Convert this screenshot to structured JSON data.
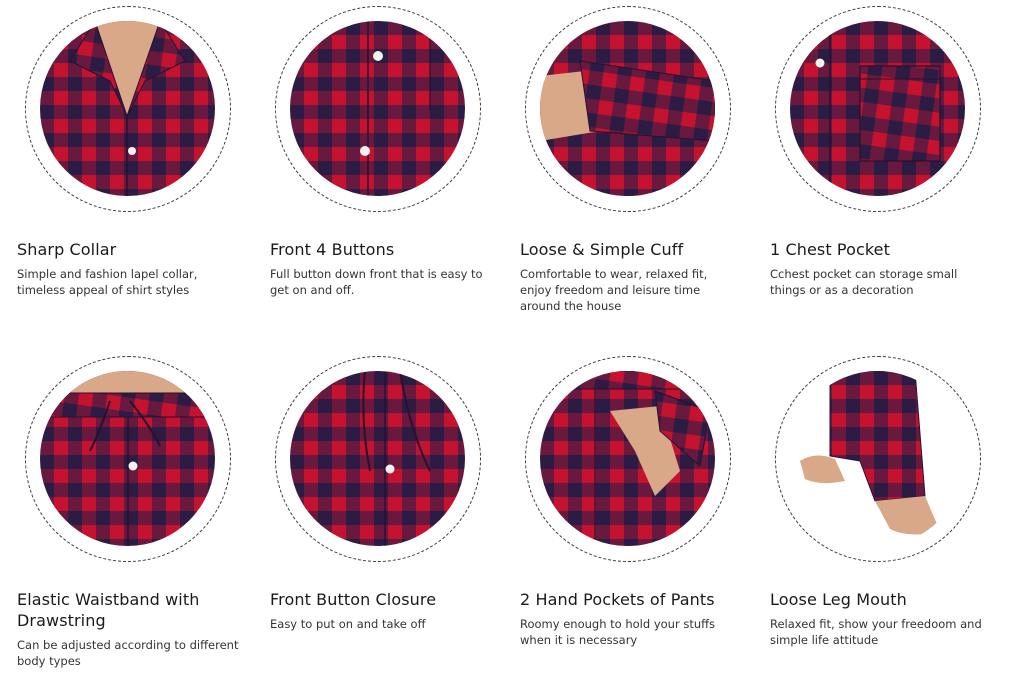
{
  "colors": {
    "plaid_red": "#c4122f",
    "plaid_navy": "#1f1f4a",
    "plaid_dark": "#3a1235",
    "skin": "#d8a888",
    "button": "#f2f2f2"
  },
  "features": [
    {
      "icon": "collar-icon",
      "title": "Sharp Collar",
      "desc": "Simple and fashion lapel collar, timeless appeal of shirt styles"
    },
    {
      "icon": "buttons-icon",
      "title": "Front 4 Buttons",
      "desc": "Full button down front that is easy to get on and off."
    },
    {
      "icon": "cuff-icon",
      "title": "Loose & Simple Cuff",
      "desc": "Comfortable to wear, relaxed fit, enjoy freedom and leisure time around the house"
    },
    {
      "icon": "chest-pocket-icon",
      "title": "1 Chest Pocket",
      "desc": "Cchest pocket can storage small things or as a decoration"
    },
    {
      "icon": "waistband-icon",
      "title": "Elastic Waistband with Drawstring",
      "desc": "Can be adjusted according to different body types"
    },
    {
      "icon": "button-closure-icon",
      "title": "Front Button Closure",
      "desc": "Easy to put on and take off"
    },
    {
      "icon": "hand-pockets-icon",
      "title": "2 Hand Pockets of Pants",
      "desc": "Roomy enough to hold your stuffs when it is necessary"
    },
    {
      "icon": "leg-mouth-icon",
      "title": "Loose Leg Mouth",
      "desc": "Relaxed fit, show your freedoom and simple life attitude"
    }
  ]
}
